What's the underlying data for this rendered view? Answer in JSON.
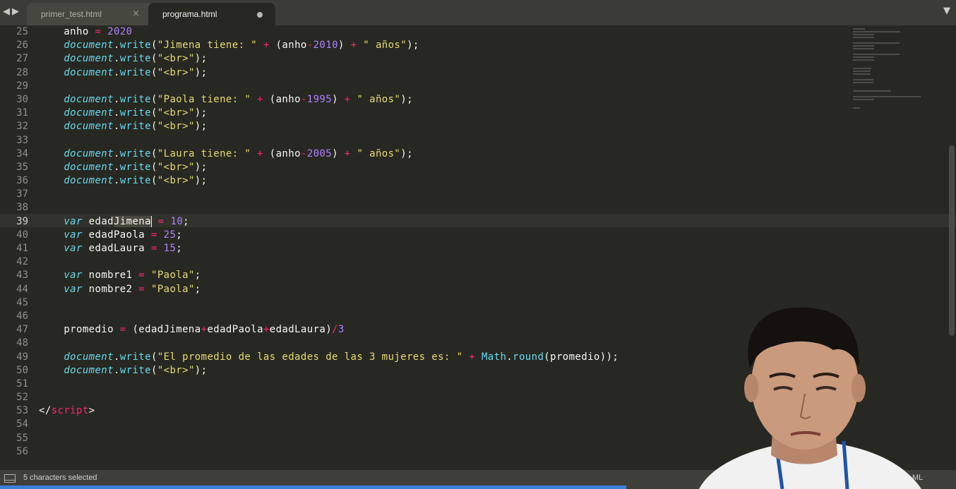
{
  "tabs": [
    {
      "label": "primer_test.html",
      "close_icon": "×",
      "active": false
    },
    {
      "label": "programa.html",
      "active": true,
      "modified": true
    }
  ],
  "nav": {
    "back_icon": "◀",
    "forward_icon": "▶",
    "tab_menu_icon": "▼"
  },
  "editor": {
    "current_line": 39,
    "lines": [
      {
        "n": 25,
        "tokens": [
          [
            "i",
            "    "
          ],
          [
            "t",
            "anho "
          ],
          [
            "o",
            "="
          ],
          [
            "t",
            " "
          ],
          [
            "n",
            "2020"
          ]
        ]
      },
      {
        "n": 26,
        "tokens": [
          [
            "i",
            "    "
          ],
          [
            "k",
            "document"
          ],
          [
            "t",
            "."
          ],
          [
            "f",
            "write"
          ],
          [
            "t",
            "("
          ],
          [
            "s",
            "\"Jimena tiene: \""
          ],
          [
            "t",
            " "
          ],
          [
            "o",
            "+"
          ],
          [
            "t",
            " (anho"
          ],
          [
            "o",
            "-"
          ],
          [
            "n",
            "2010"
          ],
          [
            "t",
            ") "
          ],
          [
            "o",
            "+"
          ],
          [
            "t",
            " "
          ],
          [
            "s",
            "\" años\""
          ],
          [
            "t",
            ");"
          ]
        ]
      },
      {
        "n": 27,
        "tokens": [
          [
            "i",
            "    "
          ],
          [
            "k",
            "document"
          ],
          [
            "t",
            "."
          ],
          [
            "f",
            "write"
          ],
          [
            "t",
            "("
          ],
          [
            "s",
            "\"<br>\""
          ],
          [
            "t",
            ");"
          ]
        ]
      },
      {
        "n": 28,
        "tokens": [
          [
            "i",
            "    "
          ],
          [
            "k",
            "document"
          ],
          [
            "t",
            "."
          ],
          [
            "f",
            "write"
          ],
          [
            "t",
            "("
          ],
          [
            "s",
            "\"<br>\""
          ],
          [
            "t",
            ");"
          ]
        ]
      },
      {
        "n": 29,
        "tokens": []
      },
      {
        "n": 30,
        "tokens": [
          [
            "i",
            "    "
          ],
          [
            "k",
            "document"
          ],
          [
            "t",
            "."
          ],
          [
            "f",
            "write"
          ],
          [
            "t",
            "("
          ],
          [
            "s",
            "\"Paola tiene: \""
          ],
          [
            "t",
            " "
          ],
          [
            "o",
            "+"
          ],
          [
            "t",
            " (anho"
          ],
          [
            "o",
            "-"
          ],
          [
            "n",
            "1995"
          ],
          [
            "t",
            ") "
          ],
          [
            "o",
            "+"
          ],
          [
            "t",
            " "
          ],
          [
            "s",
            "\" años\""
          ],
          [
            "t",
            ");"
          ]
        ]
      },
      {
        "n": 31,
        "tokens": [
          [
            "i",
            "    "
          ],
          [
            "k",
            "document"
          ],
          [
            "t",
            "."
          ],
          [
            "f",
            "write"
          ],
          [
            "t",
            "("
          ],
          [
            "s",
            "\"<br>\""
          ],
          [
            "t",
            ");"
          ]
        ]
      },
      {
        "n": 32,
        "tokens": [
          [
            "i",
            "    "
          ],
          [
            "k",
            "document"
          ],
          [
            "t",
            "."
          ],
          [
            "f",
            "write"
          ],
          [
            "t",
            "("
          ],
          [
            "s",
            "\"<br>\""
          ],
          [
            "t",
            ");"
          ]
        ]
      },
      {
        "n": 33,
        "tokens": []
      },
      {
        "n": 34,
        "tokens": [
          [
            "i",
            "    "
          ],
          [
            "k",
            "document"
          ],
          [
            "t",
            "."
          ],
          [
            "f",
            "write"
          ],
          [
            "t",
            "("
          ],
          [
            "s",
            "\"Laura tiene: \""
          ],
          [
            "t",
            " "
          ],
          [
            "o",
            "+"
          ],
          [
            "t",
            " (anho"
          ],
          [
            "o",
            "-"
          ],
          [
            "n",
            "2005"
          ],
          [
            "t",
            ") "
          ],
          [
            "o",
            "+"
          ],
          [
            "t",
            " "
          ],
          [
            "s",
            "\" años\""
          ],
          [
            "t",
            ");"
          ]
        ]
      },
      {
        "n": 35,
        "tokens": [
          [
            "i",
            "    "
          ],
          [
            "k",
            "document"
          ],
          [
            "t",
            "."
          ],
          [
            "f",
            "write"
          ],
          [
            "t",
            "("
          ],
          [
            "s",
            "\"<br>\""
          ],
          [
            "t",
            ");"
          ]
        ]
      },
      {
        "n": 36,
        "tokens": [
          [
            "i",
            "    "
          ],
          [
            "k",
            "document"
          ],
          [
            "t",
            "."
          ],
          [
            "f",
            "write"
          ],
          [
            "t",
            "("
          ],
          [
            "s",
            "\"<br>\""
          ],
          [
            "t",
            ");"
          ]
        ]
      },
      {
        "n": 37,
        "tokens": []
      },
      {
        "n": 38,
        "tokens": []
      },
      {
        "n": 39,
        "tokens": [
          [
            "i",
            "    "
          ],
          [
            "k",
            "var"
          ],
          [
            "t",
            " edad"
          ],
          [
            "x",
            "Jimena"
          ],
          [
            "c",
            ""
          ],
          [
            "t",
            " "
          ],
          [
            "o",
            "="
          ],
          [
            "t",
            " "
          ],
          [
            "n",
            "10"
          ],
          [
            "t",
            ";"
          ]
        ]
      },
      {
        "n": 40,
        "tokens": [
          [
            "i",
            "    "
          ],
          [
            "k",
            "var"
          ],
          [
            "t",
            " edadPaola "
          ],
          [
            "o",
            "="
          ],
          [
            "t",
            " "
          ],
          [
            "n",
            "25"
          ],
          [
            "t",
            ";"
          ]
        ]
      },
      {
        "n": 41,
        "tokens": [
          [
            "i",
            "    "
          ],
          [
            "k",
            "var"
          ],
          [
            "t",
            " edadLaura "
          ],
          [
            "o",
            "="
          ],
          [
            "t",
            " "
          ],
          [
            "n",
            "15"
          ],
          [
            "t",
            ";"
          ]
        ]
      },
      {
        "n": 42,
        "tokens": []
      },
      {
        "n": 43,
        "tokens": [
          [
            "i",
            "    "
          ],
          [
            "k",
            "var"
          ],
          [
            "t",
            " nombre1 "
          ],
          [
            "o",
            "="
          ],
          [
            "t",
            " "
          ],
          [
            "s",
            "\"Paola\""
          ],
          [
            "t",
            ";"
          ]
        ]
      },
      {
        "n": 44,
        "tokens": [
          [
            "i",
            "    "
          ],
          [
            "k",
            "var"
          ],
          [
            "t",
            " nombre2 "
          ],
          [
            "o",
            "="
          ],
          [
            "t",
            " "
          ],
          [
            "s",
            "\"Paola\""
          ],
          [
            "t",
            ";"
          ]
        ]
      },
      {
        "n": 45,
        "tokens": []
      },
      {
        "n": 46,
        "tokens": []
      },
      {
        "n": 47,
        "tokens": [
          [
            "i",
            "    "
          ],
          [
            "t",
            "promedio "
          ],
          [
            "o",
            "="
          ],
          [
            "t",
            " (edadJimena"
          ],
          [
            "o",
            "+"
          ],
          [
            "t",
            "edadPaola"
          ],
          [
            "o",
            "+"
          ],
          [
            "t",
            "edadLaura)"
          ],
          [
            "o",
            "/"
          ],
          [
            "n",
            "3"
          ]
        ]
      },
      {
        "n": 48,
        "tokens": []
      },
      {
        "n": 49,
        "tokens": [
          [
            "i",
            "    "
          ],
          [
            "k",
            "document"
          ],
          [
            "t",
            "."
          ],
          [
            "f",
            "write"
          ],
          [
            "t",
            "("
          ],
          [
            "s",
            "\"El promedio de las edades de las 3 mujeres es: \""
          ],
          [
            "t",
            " "
          ],
          [
            "o",
            "+"
          ],
          [
            "t",
            " "
          ],
          [
            "f",
            "Math"
          ],
          [
            "t",
            "."
          ],
          [
            "f",
            "round"
          ],
          [
            "t",
            "(promedio));"
          ]
        ]
      },
      {
        "n": 50,
        "tokens": [
          [
            "i",
            "    "
          ],
          [
            "k",
            "document"
          ],
          [
            "t",
            "."
          ],
          [
            "f",
            "write"
          ],
          [
            "t",
            "("
          ],
          [
            "s",
            "\"<br>\""
          ],
          [
            "t",
            ");"
          ]
        ]
      },
      {
        "n": 51,
        "tokens": []
      },
      {
        "n": 52,
        "tokens": []
      },
      {
        "n": 53,
        "tokens": [
          [
            "t",
            "</"
          ],
          [
            "g",
            "script"
          ],
          [
            "t",
            ">"
          ]
        ]
      },
      {
        "n": 54,
        "tokens": []
      },
      {
        "n": 55,
        "tokens": []
      },
      {
        "n": 56,
        "tokens": []
      }
    ]
  },
  "statusbar": {
    "selection_text": "5 characters selected",
    "syntax": "ML"
  },
  "colors": {
    "background": "#272822",
    "keyword": "#66d9ef",
    "string": "#e6db74",
    "number": "#ae81ff",
    "operator": "#f92672",
    "progress": "#3c7fd6"
  },
  "progress": {
    "fraction": 0.655
  }
}
